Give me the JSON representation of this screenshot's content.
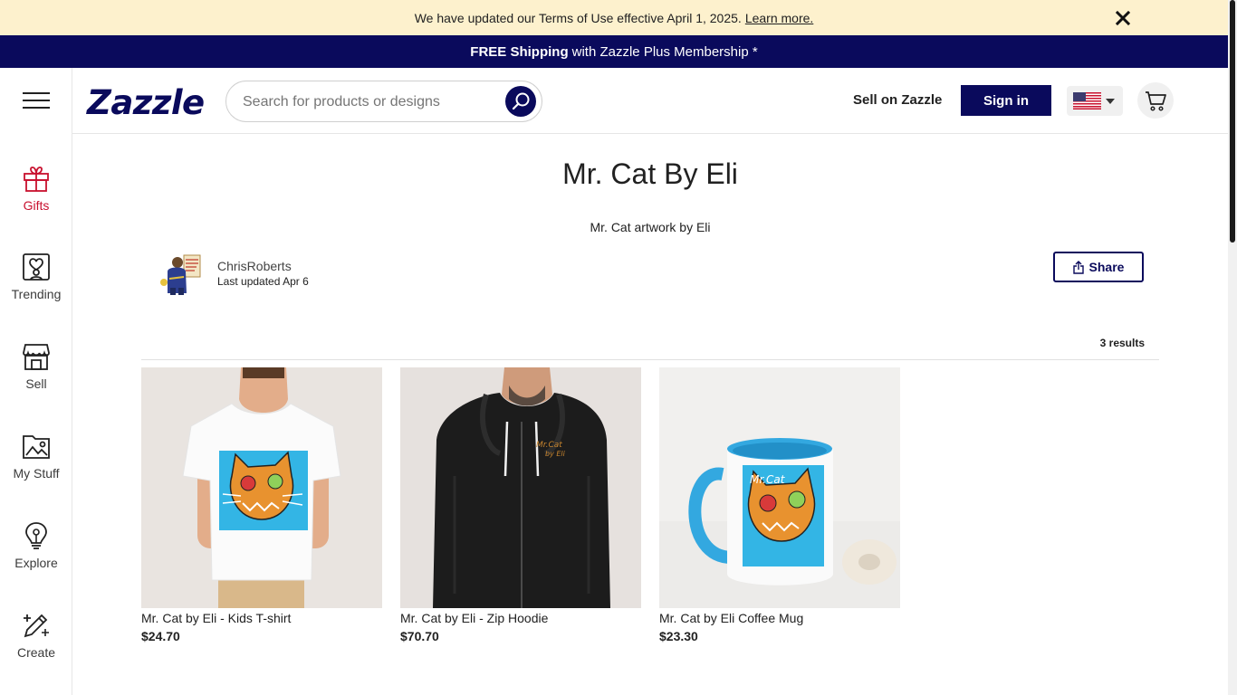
{
  "notice": {
    "text": "We have updated our Terms of Use effective April 1, 2025.",
    "link": "Learn more."
  },
  "promo": {
    "bold": "FREE Shipping",
    "rest": "with Zazzle Plus Membership *"
  },
  "sidebar": {
    "items": [
      {
        "label": "Gifts",
        "icon": "gift-icon"
      },
      {
        "label": "Trending",
        "icon": "trending-icon"
      },
      {
        "label": "Sell",
        "icon": "store-icon"
      },
      {
        "label": "My Stuff",
        "icon": "folder-image-icon"
      },
      {
        "label": "Explore",
        "icon": "lightbulb-icon"
      },
      {
        "label": "Create",
        "icon": "pencil-sparkle-icon"
      }
    ]
  },
  "header": {
    "logo": "Zazzle",
    "search_placeholder": "Search for products or designs",
    "sell_link": "Sell on Zazzle",
    "signin": "Sign in"
  },
  "collection": {
    "title": "Mr. Cat By Eli",
    "description": "Mr. Cat artwork by Eli",
    "author": "ChrisRoberts",
    "updated": "Last updated Apr 6",
    "share": "Share",
    "results": "3 results"
  },
  "products": [
    {
      "name": "Mr. Cat by Eli - Kids T-shirt",
      "price": "$24.70"
    },
    {
      "name": "Mr. Cat by Eli - Zip Hoodie",
      "price": "$70.70"
    },
    {
      "name": "Mr. Cat by Eli Coffee Mug",
      "price": "$23.30"
    }
  ],
  "colors": {
    "brand_navy": "#0a0a5c",
    "notice_bg": "#fdf1cd",
    "active_red": "#c8102e",
    "cat_bg_blue": "#33b5e5",
    "cat_orange": "#e8922f"
  }
}
